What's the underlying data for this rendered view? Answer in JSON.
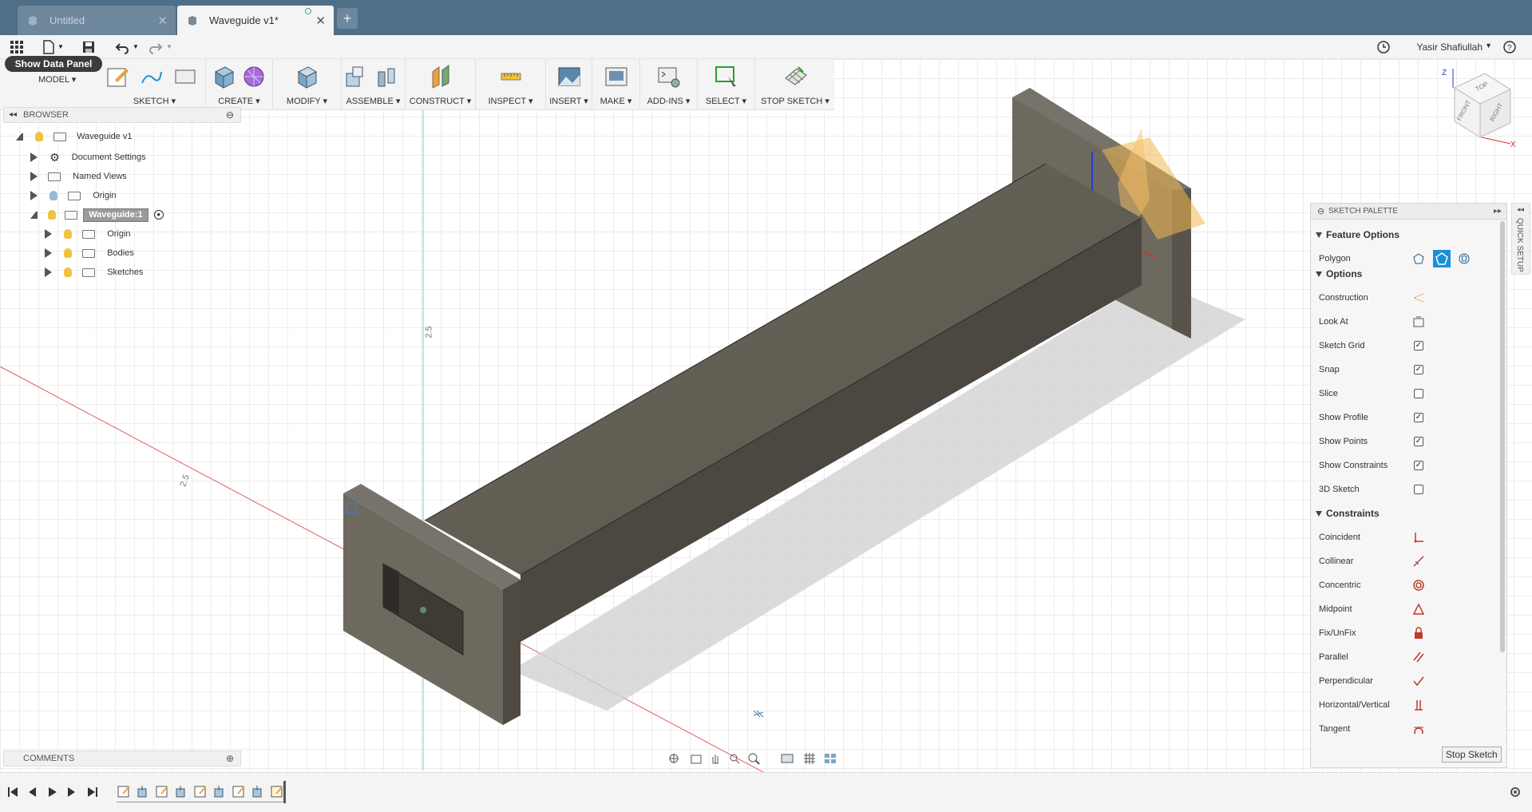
{
  "tabs": [
    {
      "label": "Untitled",
      "active": false
    },
    {
      "label": "Waveguide v1*",
      "active": true
    }
  ],
  "quickbar": {
    "user_name": "Yasir Shafiullah",
    "icons": [
      "grid-apps-icon",
      "file-icon",
      "save-icon",
      "undo-icon",
      "redo-icon",
      "clock-icon",
      "help-icon"
    ]
  },
  "toolbar": {
    "data_panel_label": "Show Data Panel",
    "workspace_label": "MODEL",
    "groups": [
      {
        "label": "SKETCH"
      },
      {
        "label": "CREATE"
      },
      {
        "label": "MODIFY"
      },
      {
        "label": "ASSEMBLE"
      },
      {
        "label": "CONSTRUCT"
      },
      {
        "label": "INSPECT"
      },
      {
        "label": "INSERT"
      },
      {
        "label": "MAKE"
      },
      {
        "label": "ADD-INS"
      },
      {
        "label": "SELECT"
      },
      {
        "label": "STOP SKETCH"
      }
    ]
  },
  "browser": {
    "title": "BROWSER",
    "items": [
      {
        "label": "Waveguide v1"
      },
      {
        "label": "Document Settings"
      },
      {
        "label": "Named Views"
      },
      {
        "label": "Origin"
      },
      {
        "label": "Waveguide:1"
      },
      {
        "label": "Origin"
      },
      {
        "label": "Bodies"
      },
      {
        "label": "Sketches"
      }
    ]
  },
  "viewport": {
    "dimension_labels": [
      "2.5",
      "2.5"
    ],
    "viewcube_faces": [
      "TOP",
      "FRONT",
      "RIGHT"
    ],
    "axis_labels": [
      "Z",
      "X"
    ]
  },
  "palette": {
    "title": "SKETCH PALETTE",
    "quick_setup": "QUICK SETUP",
    "sections": {
      "feature_options": "Feature Options",
      "options": "Options",
      "constraints": "Constraints"
    },
    "feature_options": {
      "polygon_label": "Polygon"
    },
    "options": [
      {
        "label": "Construction",
        "checked": null
      },
      {
        "label": "Look At",
        "checked": null
      },
      {
        "label": "Sketch Grid",
        "checked": true
      },
      {
        "label": "Snap",
        "checked": true
      },
      {
        "label": "Slice",
        "checked": false
      },
      {
        "label": "Show Profile",
        "checked": true
      },
      {
        "label": "Show Points",
        "checked": true
      },
      {
        "label": "Show Constraints",
        "checked": true
      },
      {
        "label": "3D Sketch",
        "checked": false
      }
    ],
    "constraints": [
      {
        "label": "Coincident",
        "icon": "coincident-icon"
      },
      {
        "label": "Collinear",
        "icon": "collinear-icon"
      },
      {
        "label": "Concentric",
        "icon": "concentric-icon"
      },
      {
        "label": "Midpoint",
        "icon": "midpoint-icon"
      },
      {
        "label": "Fix/UnFix",
        "icon": "lock-icon"
      },
      {
        "label": "Parallel",
        "icon": "parallel-icon"
      },
      {
        "label": "Perpendicular",
        "icon": "perpendicular-icon"
      },
      {
        "label": "Horizontal/Vertical",
        "icon": "horizontal-vertical-icon"
      },
      {
        "label": "Tangent",
        "icon": "tangent-icon"
      }
    ],
    "stop_button": "Stop Sketch"
  },
  "comments": {
    "title": "COMMENTS"
  },
  "colors": {
    "tab_bar": "#4f6e88",
    "accent_blue": "#1c8fd6",
    "constraint_red": "#c0392b",
    "body_gray": "#5f5a50"
  }
}
